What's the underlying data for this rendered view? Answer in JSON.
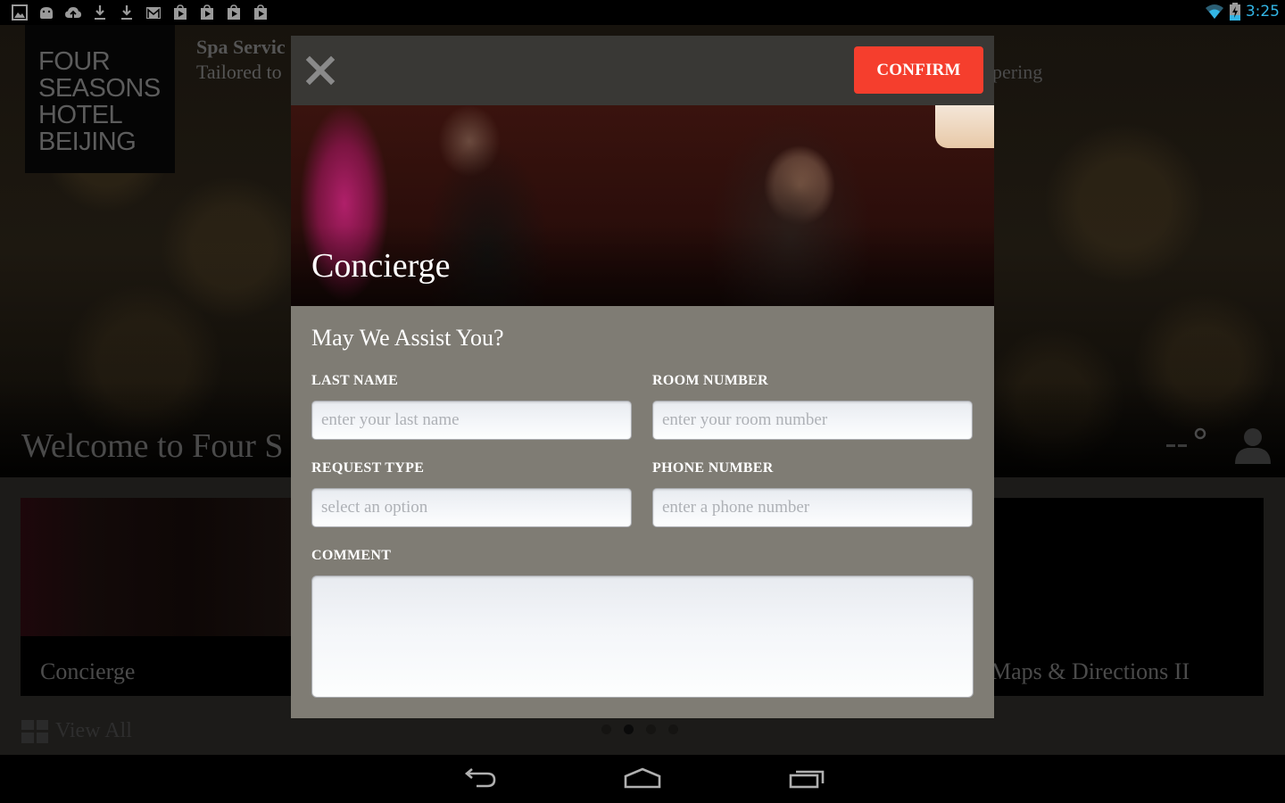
{
  "status_bar": {
    "notification_icons": [
      "gallery-icon",
      "android-icon",
      "cloud-upload-icon",
      "download-icon",
      "download-icon",
      "gmail-icon",
      "play-store-icon",
      "play-store-icon",
      "play-store-icon",
      "play-store-icon"
    ],
    "wifi": "wifi-icon",
    "battery": "battery-charging-icon",
    "time": "3:25",
    "accent_color": "#33b5e5"
  },
  "background_app": {
    "logo_lines": [
      "FOUR",
      "SEASONS",
      "HOTEL",
      "BEIJING"
    ],
    "promo": {
      "title": "Spa Servic",
      "subtitle": "Tailored to",
      "subtitle_right": "pering"
    },
    "welcome_text": "Welcome to Four S",
    "weather_readout": "--°",
    "tiles": [
      {
        "label": "Concierge"
      },
      {
        "label": "Maps & Directions II"
      }
    ],
    "view_all_label": "View All",
    "pager": {
      "count": 4,
      "active_index": 1
    }
  },
  "modal": {
    "confirm_label": "CONFIRM",
    "confirm_color": "#f53e2d",
    "banner_title": "Concierge",
    "form_title": "May We Assist You?",
    "fields": {
      "last_name": {
        "label": "LAST NAME",
        "placeholder": "enter your last name",
        "value": ""
      },
      "room_number": {
        "label": "ROOM NUMBER",
        "placeholder": "enter your room number",
        "value": ""
      },
      "request_type": {
        "label": "REQUEST TYPE",
        "placeholder": "select an option",
        "value": ""
      },
      "phone_number": {
        "label": "PHONE NUMBER",
        "placeholder": "enter a phone number",
        "value": ""
      },
      "comment": {
        "label": "COMMENT",
        "value": ""
      }
    }
  },
  "nav_bar": {
    "buttons": [
      "back-icon",
      "home-icon",
      "recent-apps-icon"
    ]
  }
}
